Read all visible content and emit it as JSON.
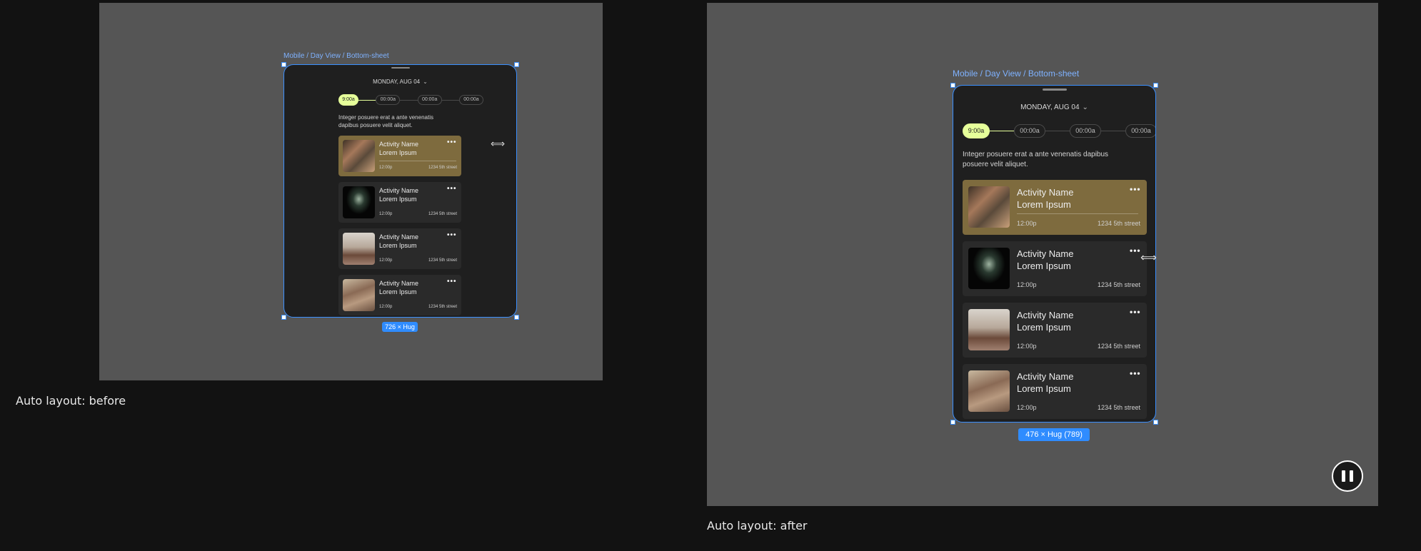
{
  "colors": {
    "canvas_bg": "#555555",
    "page_bg": "#121212",
    "card_bg": "#2a2a2a",
    "highlight": "#7e6b3e",
    "accent_pill": "#e6ff9a",
    "selection": "#3a8fff"
  },
  "icons": {
    "more": "more-horizontal-icon",
    "chevron": "chevron-down-icon",
    "resize": "resize-cursor-icon",
    "pause": "pause-icon"
  },
  "before": {
    "caption": "Auto layout: before",
    "frame_label": "Mobile / Day View / Bottom-sheet",
    "size_badge": "726 × Hug",
    "date": "MONDAY, AUG 04",
    "times": [
      "9:00a",
      "00:00a",
      "00:00a",
      "00:00a"
    ],
    "description": "Integer posuere erat a ante venenatis dapibus posuere velit aliquet.",
    "cards": [
      {
        "name_line1": "Activity Name",
        "name_line2": "Lorem Ipsum",
        "time": "12:00p",
        "street": "1234 5th street",
        "highlight": true
      },
      {
        "name_line1": "Activity Name",
        "name_line2": "Lorem Ipsum",
        "time": "12:00p",
        "street": "1234 5th street",
        "highlight": false
      },
      {
        "name_line1": "Activity Name",
        "name_line2": "Lorem Ipsum",
        "time": "12:00p",
        "street": "1234 5th street",
        "highlight": false
      },
      {
        "name_line1": "Activity Name",
        "name_line2": "Lorem Ipsum",
        "time": "12:00p",
        "street": "1234 5th street",
        "highlight": false
      }
    ]
  },
  "after": {
    "caption": "Auto layout: after",
    "frame_label": "Mobile / Day View / Bottom-sheet",
    "size_badge": "476 × Hug (789)",
    "date": "MONDAY, AUG 04",
    "times": [
      "9:00a",
      "00:00a",
      "00:00a",
      "00:00a"
    ],
    "description": "Integer posuere erat a ante venenatis dapibus posuere velit aliquet.",
    "cards": [
      {
        "name_line1": "Activity Name",
        "name_line2": "Lorem Ipsum",
        "time": "12:00p",
        "street": "1234 5th street",
        "highlight": true
      },
      {
        "name_line1": "Activity Name",
        "name_line2": "Lorem Ipsum",
        "time": "12:00p",
        "street": "1234 5th street",
        "highlight": false
      },
      {
        "name_line1": "Activity Name",
        "name_line2": "Lorem Ipsum",
        "time": "12:00p",
        "street": "1234 5th street",
        "highlight": false
      },
      {
        "name_line1": "Activity Name",
        "name_line2": "Lorem Ipsum",
        "time": "12:00p",
        "street": "1234 5th street",
        "highlight": false
      }
    ]
  }
}
